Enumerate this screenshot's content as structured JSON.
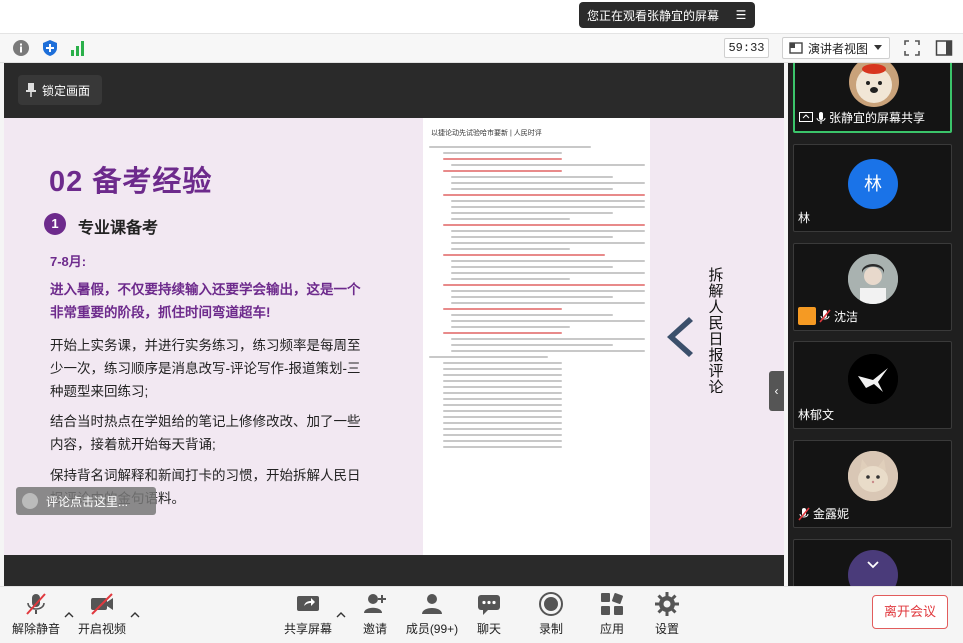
{
  "window": {
    "sharing_banner": "您正在观看张静宜的屏幕",
    "timer": "59:33",
    "view_mode": "演讲者视图"
  },
  "stage": {
    "lock_label": "锁定画面",
    "caption_label": "评论点击这里..."
  },
  "slide": {
    "title": "02 备考经验",
    "badge": "1",
    "subtitle": "专业课备考",
    "date": "7-8月:",
    "emphasis": "进入暑假，不仅要持续输入还要学会输出，这是一个非常重要的阶段，抓住时间弯道超车!",
    "para1": "开始上实务课，并进行实务练习，练习频率是每周至少一次，练习顺序是消息改写-评论写作-报道策划-三种题型来回练习;",
    "para2": "结合当时热点在学姐给的笔记上修修改改、加了一些内容，接着就开始每天背诵;",
    "para3": "保持背名词解释和新闻打卡的习惯，开始拆解人民日报评论中的金句语料。",
    "doc_title": "以捷论动先试验哈市要新 | 人民时评",
    "vertical_text": "拆解人民日报评论"
  },
  "participants": [
    {
      "name": "张静宜的屏幕共享",
      "avatar": "dog-avatar",
      "active": true
    },
    {
      "name": "林",
      "avatar": "initial-avatar",
      "initial": "林",
      "color": "#1a73e8"
    },
    {
      "name": "沈洁",
      "avatar": "photo-avatar",
      "muted": true
    },
    {
      "name": "林郁文",
      "avatar": "bird-avatar"
    },
    {
      "name": "金露妮",
      "avatar": "cat-avatar",
      "muted": true
    },
    {
      "name": "",
      "avatar": "purple-avatar"
    }
  ],
  "bottom": {
    "mute": "解除静音",
    "video": "开启视频",
    "share": "共享屏幕",
    "invite": "邀请",
    "members": "成员(99+)",
    "chat": "聊天",
    "record": "录制",
    "apps": "应用",
    "settings": "设置",
    "leave": "离开会议"
  }
}
